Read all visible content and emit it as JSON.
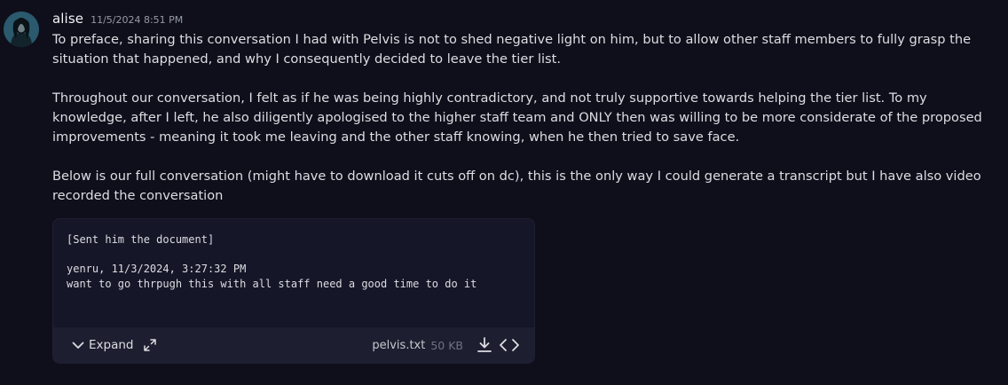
{
  "message": {
    "author": "alise",
    "timestamp": "11/5/2024 8:51 PM",
    "paragraphs": [
      "To preface, sharing this conversation I had with Pelvis is not to shed negative light on him, but to allow other staff members to fully grasp the situation that happened, and why I consequently decided to leave the tier list.",
      "Throughout our conversation, I felt as if he was being highly contradictory, and not truly supportive towards helping the tier list. To my knowledge, after I left, he also diligently apologised to the higher staff team and ONLY then was willing to be more considerate of the proposed improvements - meaning it took me leaving and the other staff knowing, when he then tried to save face.",
      "Below is our full conversation (might have to download it cuts off on dc), this is the only way I could generate a transcript but I have also video recorded the conversation"
    ]
  },
  "attachment": {
    "lines": [
      "[Sent him the document]",
      "",
      "yenru, 11/3/2024, 3:27:32 PM",
      "want to go thrpugh this with all staff need a good time to do it"
    ],
    "expand_label": "Expand",
    "filename": "pelvis.txt",
    "filesize": "50 KB"
  },
  "icons": {
    "avatar": "user-avatar",
    "expand": "chevron-down-icon",
    "fullscreen": "expand-arrows-icon",
    "download": "download-icon",
    "code": "code-brackets-icon"
  },
  "colors": {
    "background": "#0f0f1c",
    "attachment_bg": "#161629",
    "attachment_footer": "#1e1e31",
    "text": "#dbdee1",
    "muted": "#949ba4"
  }
}
